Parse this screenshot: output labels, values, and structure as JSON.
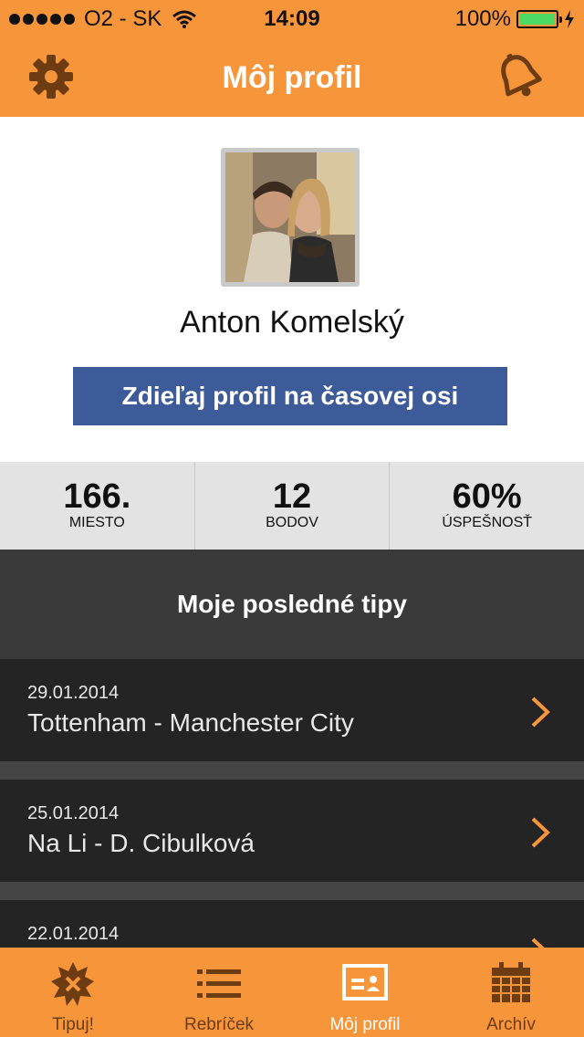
{
  "status_bar": {
    "carrier": "O2 - SK",
    "time": "14:09",
    "battery": "100%"
  },
  "navbar": {
    "title": "Môj profil",
    "left_icon": "gear-icon",
    "right_icon": "bell-icon"
  },
  "profile": {
    "name": "Anton Komelský",
    "share_label": "Zdieľaj profil na časovej osi"
  },
  "stats": [
    {
      "value": "166.",
      "label": "MIESTO"
    },
    {
      "value": "12",
      "label": "BODOV"
    },
    {
      "value": "60%",
      "label": "ÚSPEŠNOSŤ"
    }
  ],
  "tips": {
    "header": "Moje posledné tipy",
    "items": [
      {
        "date": "29.01.2014",
        "match": "Tottenham - Manchester City"
      },
      {
        "date": "25.01.2014",
        "match": "Na Li - D. Cibulková"
      },
      {
        "date": "22.01.2014",
        "match": ""
      }
    ]
  },
  "tabbar": {
    "tabs": [
      {
        "label": "Tipuj!",
        "icon": "ball-burst-icon"
      },
      {
        "label": "Rebríček",
        "icon": "list-icon"
      },
      {
        "label": "Môj profil",
        "icon": "id-card-icon"
      },
      {
        "label": "Archív",
        "icon": "calendar-icon"
      }
    ],
    "active": "Môj profil"
  },
  "colors": {
    "accent": "#f7953b",
    "facebook": "#3d5a99",
    "chevron": "#f7953b"
  }
}
